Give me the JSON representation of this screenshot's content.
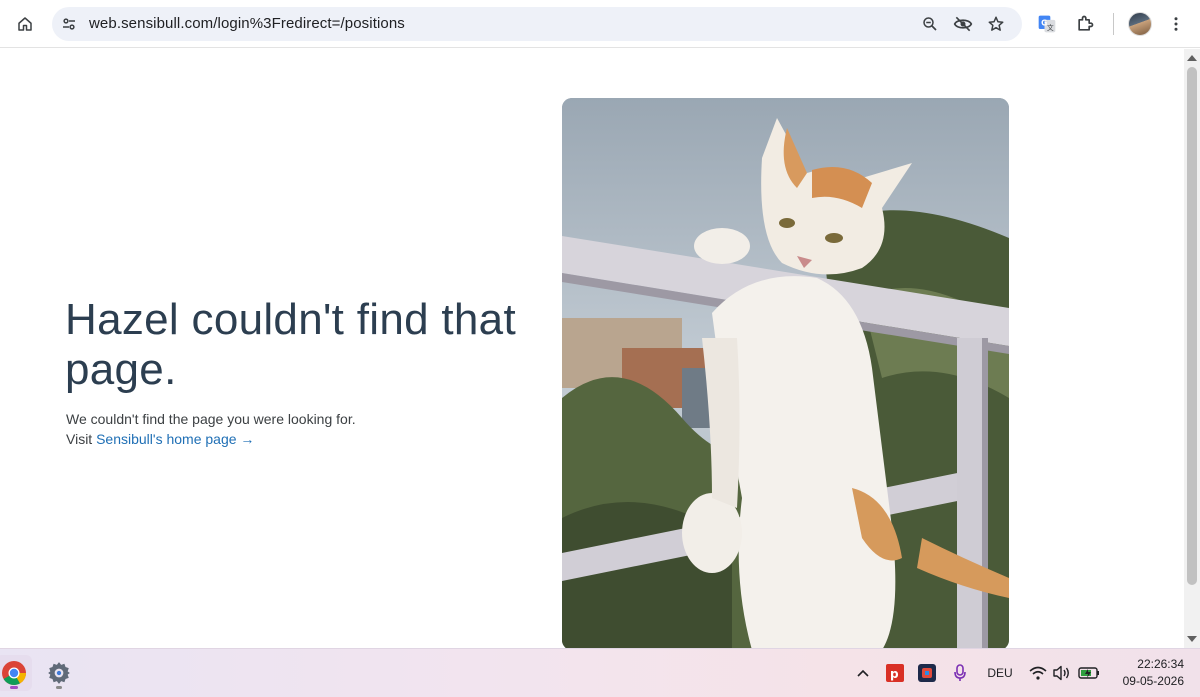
{
  "browser": {
    "url": "web.sensibull.com/login%3Fredirect=/positions"
  },
  "page": {
    "headline": "Hazel couldn't find that page.",
    "message": "We couldn't find the page you were looking for.",
    "visit_prefix": "Visit",
    "home_link": "Sensibull's home page",
    "link_arrow": "→"
  },
  "taskbar": {
    "language": "DEU",
    "time": "22:26:34",
    "date": "09-05-2026"
  },
  "colors": {
    "headline": "#2c3e50",
    "link": "#1f6fb5",
    "omnibox_bg": "#eef1f8"
  }
}
